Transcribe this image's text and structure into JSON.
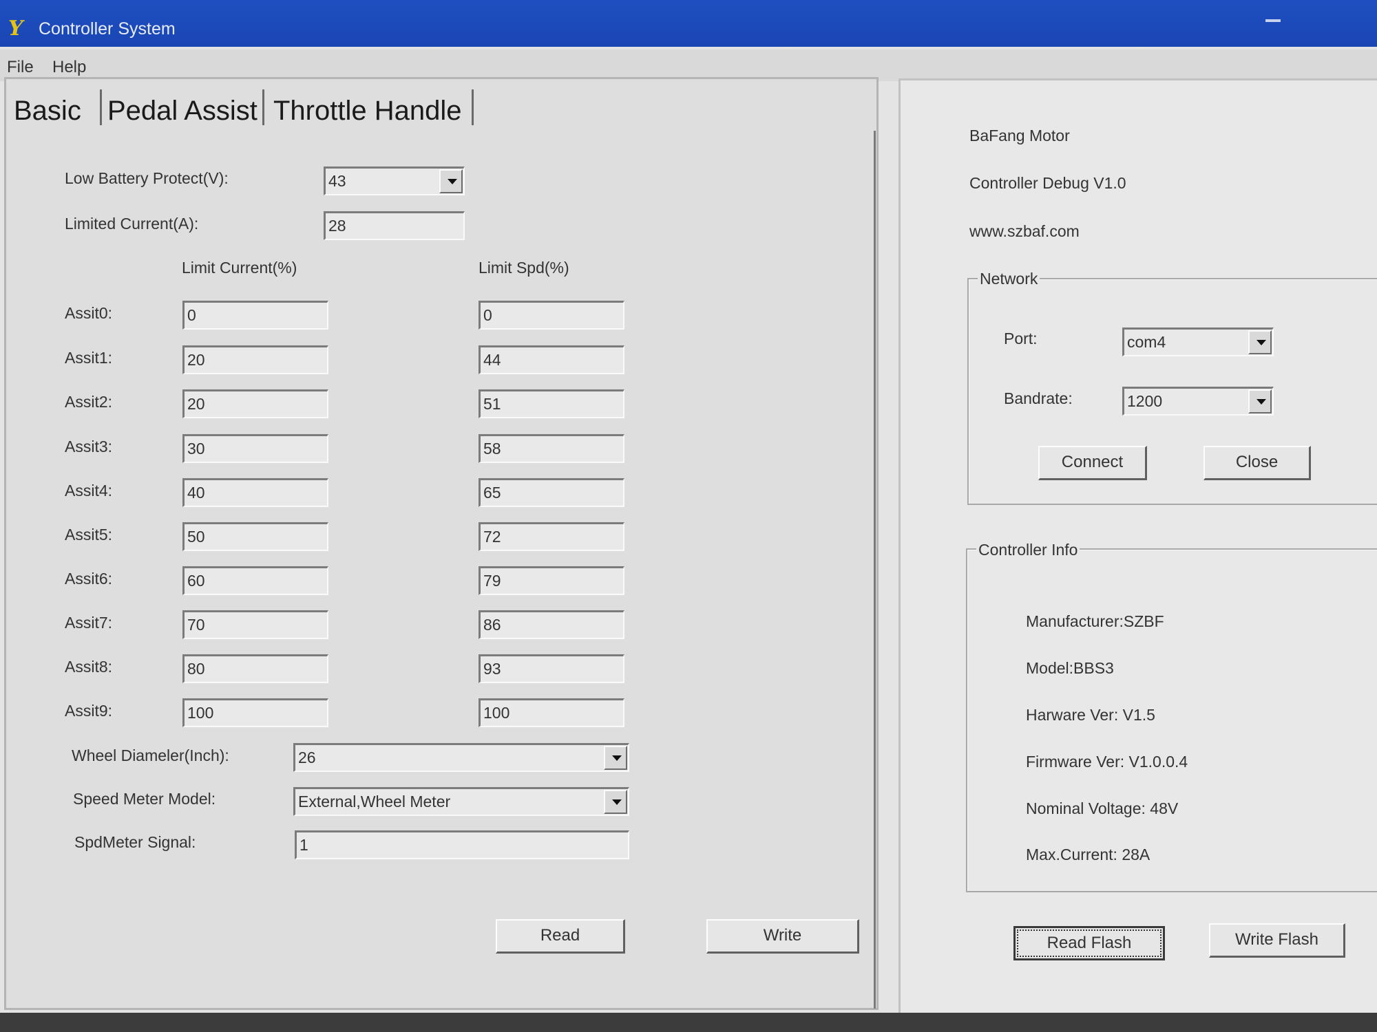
{
  "window": {
    "title": "Controller System"
  },
  "menu": {
    "file": "File",
    "help": "Help"
  },
  "tabs": [
    "Basic",
    "Pedal Assist",
    "Throttle Handle"
  ],
  "basic": {
    "low_battery_label": "Low Battery Protect(V):",
    "low_battery_value": "43",
    "limited_current_label": "Limited Current(A):",
    "limited_current_value": "28",
    "limit_current_header": "Limit Current(%)",
    "limit_spd_header": "Limit Spd(%)",
    "assists": [
      {
        "label": "Assit0:",
        "current": "0",
        "speed": "0"
      },
      {
        "label": "Assit1:",
        "current": "20",
        "speed": "44"
      },
      {
        "label": "Assit2:",
        "current": "20",
        "speed": "51"
      },
      {
        "label": "Assit3:",
        "current": "30",
        "speed": "58"
      },
      {
        "label": "Assit4:",
        "current": "40",
        "speed": "65"
      },
      {
        "label": "Assit5:",
        "current": "50",
        "speed": "72"
      },
      {
        "label": "Assit6:",
        "current": "60",
        "speed": "79"
      },
      {
        "label": "Assit7:",
        "current": "70",
        "speed": "86"
      },
      {
        "label": "Assit8:",
        "current": "80",
        "speed": "93"
      },
      {
        "label": "Assit9:",
        "current": "100",
        "speed": "100"
      }
    ],
    "wheel_diameter_label": "Wheel Diameler(Inch):",
    "wheel_diameter_value": "26",
    "speed_meter_model_label": "Speed Meter Model:",
    "speed_meter_model_value": "External,Wheel Meter",
    "spdmeter_signal_label": "SpdMeter Signal:",
    "spdmeter_signal_value": "1",
    "read_label": "Read",
    "write_label": "Write"
  },
  "about": {
    "line1": "BaFang Motor",
    "line2": "Controller Debug V1.0",
    "line3": "www.szbaf.com"
  },
  "network": {
    "title": "Network",
    "port_label": "Port:",
    "port_value": "com4",
    "baud_label": "Bandrate:",
    "baud_value": "1200",
    "connect_label": "Connect",
    "close_label": "Close"
  },
  "controller_info": {
    "title": "Controller Info",
    "manufacturer": "Manufacturer:SZBF",
    "model": "Model:BBS3",
    "hardware": "Harware Ver: V1.5",
    "firmware": "Firmware Ver: V1.0.0.4",
    "voltage": "Nominal Voltage: 48V",
    "current": "Max.Current: 28A"
  },
  "flash": {
    "read_label": "Read Flash",
    "write_label": "Write Flash"
  }
}
